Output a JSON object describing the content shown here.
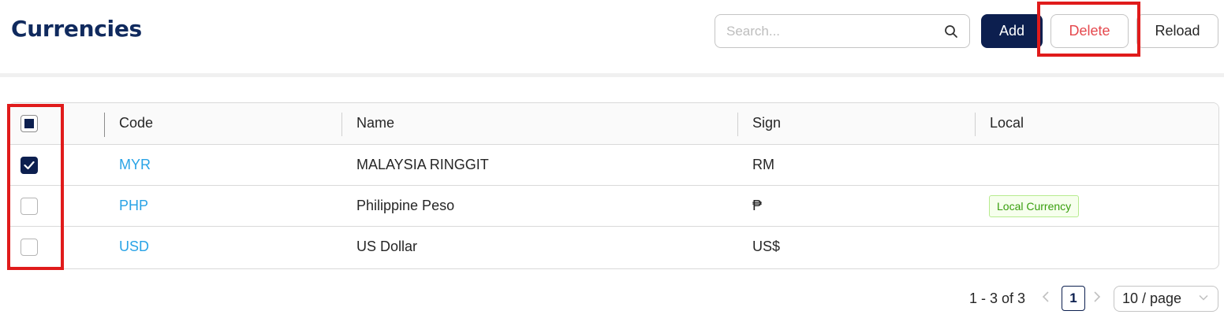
{
  "header": {
    "title": "Currencies",
    "search_placeholder": "Search...",
    "search_value": "",
    "add_label": "Add",
    "delete_label": "Delete",
    "reload_label": "Reload"
  },
  "table": {
    "columns": [
      "Code",
      "Name",
      "Sign",
      "Local"
    ],
    "rows": [
      {
        "code": "MYR",
        "name": "MALAYSIA RINGGIT",
        "sign": "RM",
        "local": "",
        "checked": true
      },
      {
        "code": "PHP",
        "name": "Philippine Peso",
        "sign": "₱",
        "local": "Local Currency",
        "checked": false
      },
      {
        "code": "USD",
        "name": "US Dollar",
        "sign": "US$",
        "local": "",
        "checked": false
      }
    ],
    "header_checkbox_state": "indeterminate"
  },
  "pagination": {
    "total_text": "1 - 3 of 3",
    "prev_icon": "chevron-left-icon",
    "next_icon": "chevron-right-icon",
    "current_page": "1",
    "page_size": "10 / page"
  },
  "colors": {
    "title": "#102a5e",
    "primary": "#0c1f4f",
    "danger": "#e5484d",
    "link": "#29a3e6",
    "highlight": "#e01b1b",
    "tag_text": "#389e0d",
    "tag_bg": "#f6ffed"
  }
}
